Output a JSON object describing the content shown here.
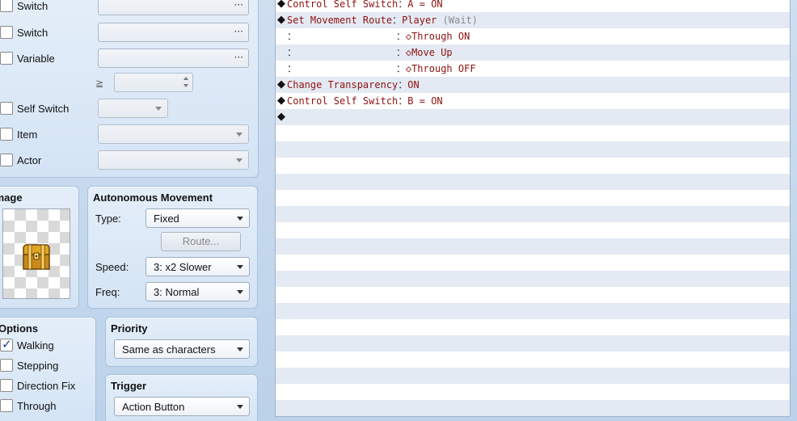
{
  "conditions": {
    "switch1": {
      "label": "Switch",
      "checked": false
    },
    "switch2": {
      "label": "Switch",
      "checked": false
    },
    "variable": {
      "label": "Variable",
      "checked": false
    },
    "variable_op": "≧",
    "self_switch": {
      "label": "Self Switch",
      "checked": false
    },
    "item": {
      "label": "Item",
      "checked": false
    },
    "actor": {
      "label": "Actor",
      "checked": false
    },
    "dots": "···"
  },
  "image": {
    "title": "Image",
    "icon": "treasure-chest-icon"
  },
  "autonomous_movement": {
    "title": "Autonomous Movement",
    "type_label": "Type:",
    "type_value": "Fixed",
    "route_button": "Route...",
    "speed_label": "Speed:",
    "speed_value": "3: x2 Slower",
    "freq_label": "Freq:",
    "freq_value": "3: Normal"
  },
  "options": {
    "title": "Options",
    "walking": {
      "label": "Walking",
      "checked": true
    },
    "stepping": {
      "label": "Stepping",
      "checked": false
    },
    "direction_fix": {
      "label": "Direction Fix",
      "checked": false
    },
    "through": {
      "label": "Through",
      "checked": false
    }
  },
  "priority": {
    "title": "Priority",
    "value": "Same as characters"
  },
  "trigger": {
    "title": "Trigger",
    "value": "Action Button"
  },
  "event_commands": [
    {
      "marker": "◆",
      "command": "Control Self Switch",
      "sep": "：",
      "args": "A = ON",
      "extra": ""
    },
    {
      "marker": "◆",
      "command": "Set Movement Route",
      "sep": "：",
      "args": "Player ",
      "extra": "(Wait)"
    },
    {
      "marker": "",
      "command": "：                 ",
      "sep": "：",
      "args": "◇Through ON",
      "extra": ""
    },
    {
      "marker": "",
      "command": "：                 ",
      "sep": "：",
      "args": "◇Move Up",
      "extra": ""
    },
    {
      "marker": "",
      "command": "：                 ",
      "sep": "：",
      "args": "◇Through OFF",
      "extra": ""
    },
    {
      "marker": "◆",
      "command": "Change Transparency",
      "sep": "：",
      "args": "ON",
      "extra": ""
    },
    {
      "marker": "◆",
      "command": "Control Self Switch",
      "sep": "：",
      "args": "B = ON",
      "extra": ""
    },
    {
      "marker": "◆",
      "command": "",
      "sep": "",
      "args": "",
      "extra": ""
    }
  ],
  "colors": {
    "command_text": "#8e1111",
    "alt_row": "#e4eaf3",
    "panel_bg": "#dce8f6"
  }
}
